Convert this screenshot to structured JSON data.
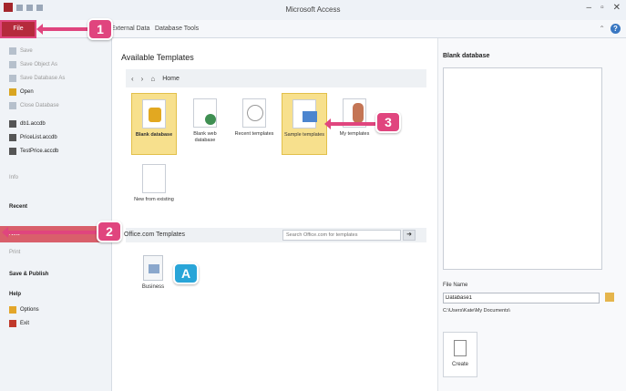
{
  "window": {
    "title": "Microsoft Access"
  },
  "window_controls": {
    "minimize": "–",
    "maximize": "▫",
    "close": "✕"
  },
  "ribbon": {
    "file_tab": "File",
    "tabs": [
      "External Data",
      "Database Tools"
    ],
    "minimize_ribbon": "⌃",
    "help": "?"
  },
  "backstage": {
    "items": [
      {
        "label": "Save"
      },
      {
        "label": "Save Object As"
      },
      {
        "label": "Save Database As"
      },
      {
        "label": "Open"
      },
      {
        "label": "Close Database"
      },
      {
        "label": "db1.accdb"
      },
      {
        "label": "PriceList.accdb"
      },
      {
        "label": "TestPrice.accdb"
      },
      {
        "label": "Info"
      },
      {
        "label": "Recent"
      },
      {
        "label": "New"
      },
      {
        "label": "Print"
      },
      {
        "label": "Save & Publish"
      },
      {
        "label": "Help"
      },
      {
        "label": "Options"
      },
      {
        "label": "Exit"
      }
    ]
  },
  "main": {
    "title": "Available Templates",
    "nav": {
      "back": "‹",
      "forward": "›",
      "home": "Home"
    },
    "templates": [
      {
        "label": "Blank database"
      },
      {
        "label": "Blank web database"
      },
      {
        "label": "Recent templates"
      },
      {
        "label": "Sample templates"
      },
      {
        "label": "My templates"
      },
      {
        "label": "New from existing"
      }
    ],
    "office_label": "Office.com Templates",
    "search_placeholder": "Search Office.com for templates",
    "search_go": "➜",
    "business_label": "Business"
  },
  "right_panel": {
    "title": "Blank database",
    "file_name_label": "File Name",
    "file_name_value": "Database1",
    "path": "C:\\Users\\Kate\\My Documents\\",
    "create_label": "Create"
  },
  "callouts": {
    "one": "1",
    "two": "2",
    "three": "3",
    "a": "A"
  },
  "colors": {
    "file_tab": "#b52a3c",
    "callout_pink": "#e0457e",
    "callout_blue": "#29a5d8",
    "selection": "#f7e08d"
  }
}
